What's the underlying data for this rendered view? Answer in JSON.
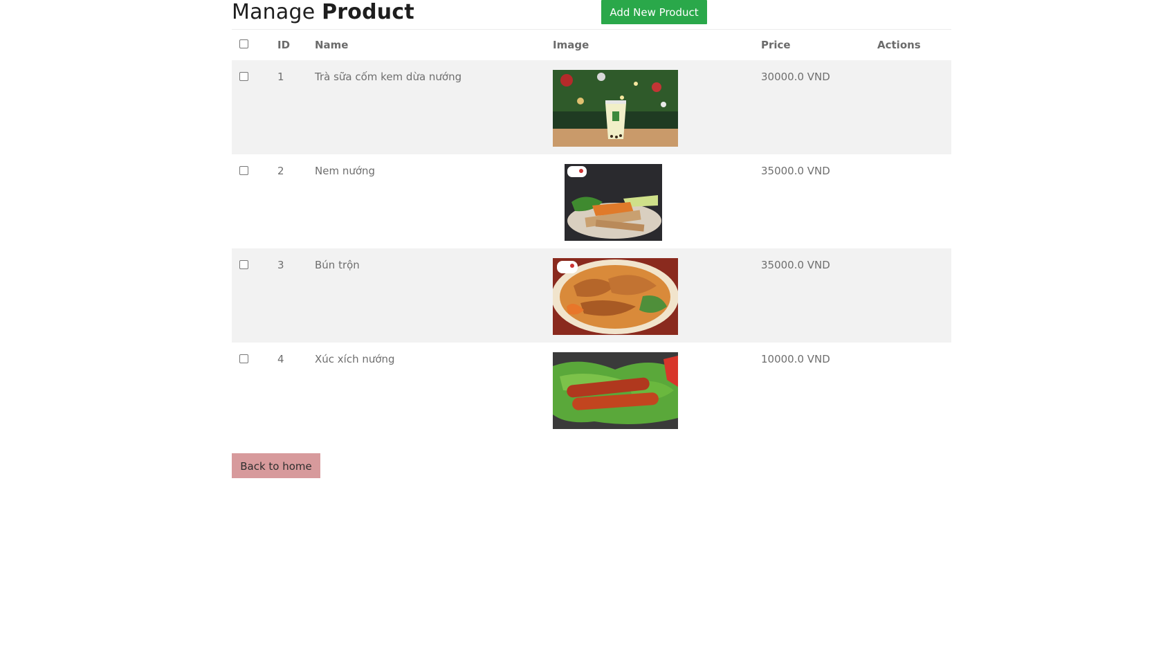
{
  "header": {
    "title_regular": "Manage",
    "title_bold": "Product",
    "add_button_label": "Add New Product"
  },
  "table": {
    "columns": {
      "id": "ID",
      "name": "Name",
      "image": "Image",
      "price": "Price",
      "actions": "Actions"
    },
    "rows": [
      {
        "id": "1",
        "name": "Trà sữa cốm kem dừa nướng",
        "price": "30000.0 VND",
        "image_icon": "milk-tea-image"
      },
      {
        "id": "2",
        "name": "Nem nướng",
        "price": "35000.0 VND",
        "image_icon": "grilled-pork-roll-image"
      },
      {
        "id": "3",
        "name": "Bún trộn",
        "price": "35000.0 VND",
        "image_icon": "mixed-noodle-image"
      },
      {
        "id": "4",
        "name": "Xúc xích nướng",
        "price": "10000.0 VND",
        "image_icon": "grilled-sausage-image"
      }
    ]
  },
  "footer": {
    "back_button_label": "Back to home"
  },
  "colors": {
    "add_button": "#2aa84a",
    "back_button": "#d79a9c",
    "row_shade": "#f2f2f2"
  }
}
